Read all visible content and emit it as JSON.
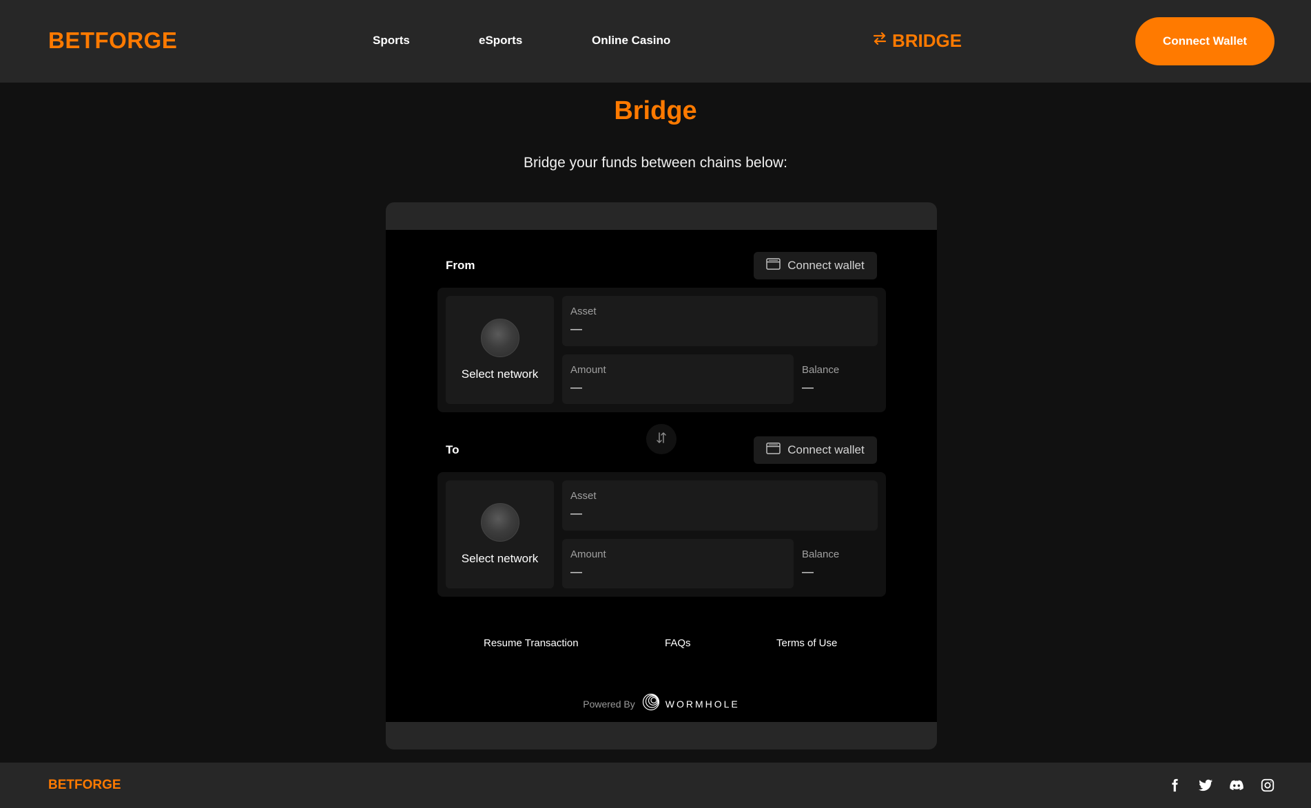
{
  "header": {
    "logo": "BETFORGE",
    "nav": [
      "Sports",
      "eSports",
      "Online Casino"
    ],
    "bridge_label": "BRIDGE",
    "connect_label": "Connect Wallet"
  },
  "page": {
    "title": "Bridge",
    "subtitle": "Bridge your funds between chains below:"
  },
  "bridge": {
    "from": {
      "label": "From",
      "connect_label": "Connect wallet",
      "network_label": "Select network",
      "asset_label": "Asset",
      "asset_value": "—",
      "amount_label": "Amount",
      "amount_value": "—",
      "balance_label": "Balance",
      "balance_value": "—"
    },
    "to": {
      "label": "To",
      "connect_label": "Connect wallet",
      "network_label": "Select network",
      "asset_label": "Asset",
      "asset_value": "—",
      "amount_label": "Amount",
      "amount_value": "—",
      "balance_label": "Balance",
      "balance_value": "—"
    },
    "links": [
      "Resume Transaction",
      "FAQs",
      "Terms of Use"
    ],
    "powered_by": "Powered By",
    "wormhole": "WORMHOLE"
  },
  "footer": {
    "logo": "BETFORGE",
    "socials": [
      "facebook-icon",
      "twitter-icon",
      "discord-icon",
      "instagram-icon"
    ]
  },
  "colors": {
    "accent": "#ff7a00",
    "header_bg": "#272727",
    "page_bg": "#111111",
    "widget_bg": "#000000"
  }
}
